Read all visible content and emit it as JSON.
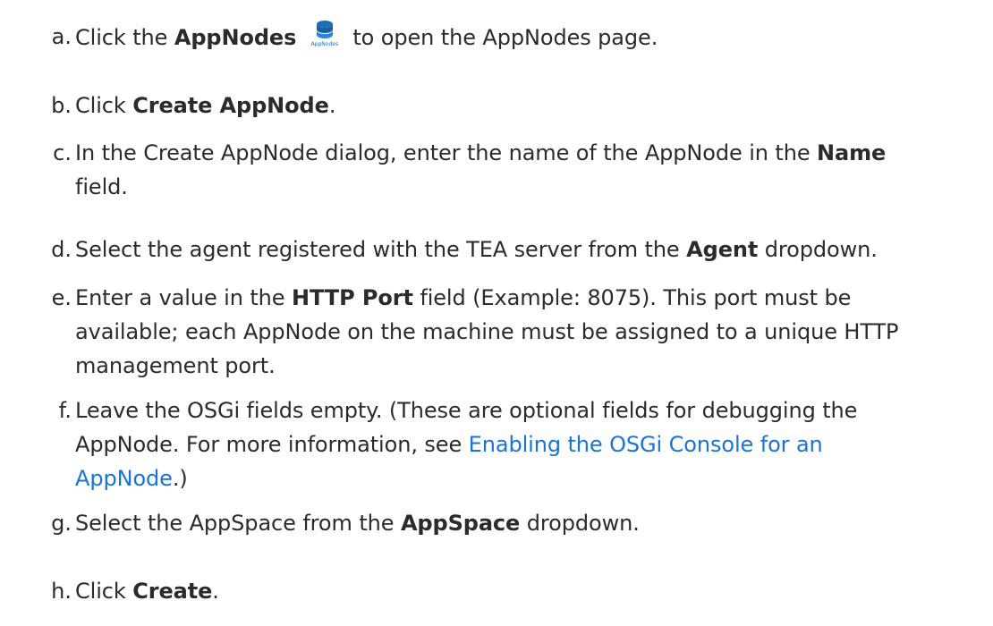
{
  "steps": [
    {
      "marker": "a.",
      "pre": "Click the ",
      "bold": "AppNodes",
      "icon_name": "appnodes-icon",
      "icon_caption": "AppNodes",
      "post": " to open the AppNodes page."
    },
    {
      "marker": "b.",
      "pre": "Click ",
      "bold": "Create AppNode",
      "post": "."
    },
    {
      "marker": "c.",
      "pre": "In the Create AppNode dialog, enter the name of the AppNode in the ",
      "bold": "Name",
      "post_line2": "field."
    },
    {
      "marker": "d.",
      "pre": "Select the agent registered with the TEA server from the ",
      "bold": "Agent",
      "post": " dropdown."
    },
    {
      "marker": "e.",
      "pre": "Enter a value in the ",
      "bold": "HTTP Port",
      "post": " field (Example: 8075). This port must be",
      "line2": "available; each AppNode on the machine must be assigned to a unique HTTP",
      "line3": "management port."
    },
    {
      "marker": "f.",
      "line1": "Leave the OSGi fields empty. (These are optional fields for debugging the",
      "line2_pre": "AppNode. For more information, see ",
      "link_part1": "Enabling the OSGi Console for an",
      "link_part2": "AppNode",
      "line3_post": ".)"
    },
    {
      "marker": "g.",
      "pre": "Select the AppSpace from the ",
      "bold": "AppSpace",
      "post": " dropdown."
    },
    {
      "marker": "h.",
      "pre": "Click ",
      "bold": "Create",
      "post": "."
    }
  ],
  "colors": {
    "link": "#1a73d8",
    "text": "#2b2b2b",
    "icon": "#1e6fb8"
  }
}
